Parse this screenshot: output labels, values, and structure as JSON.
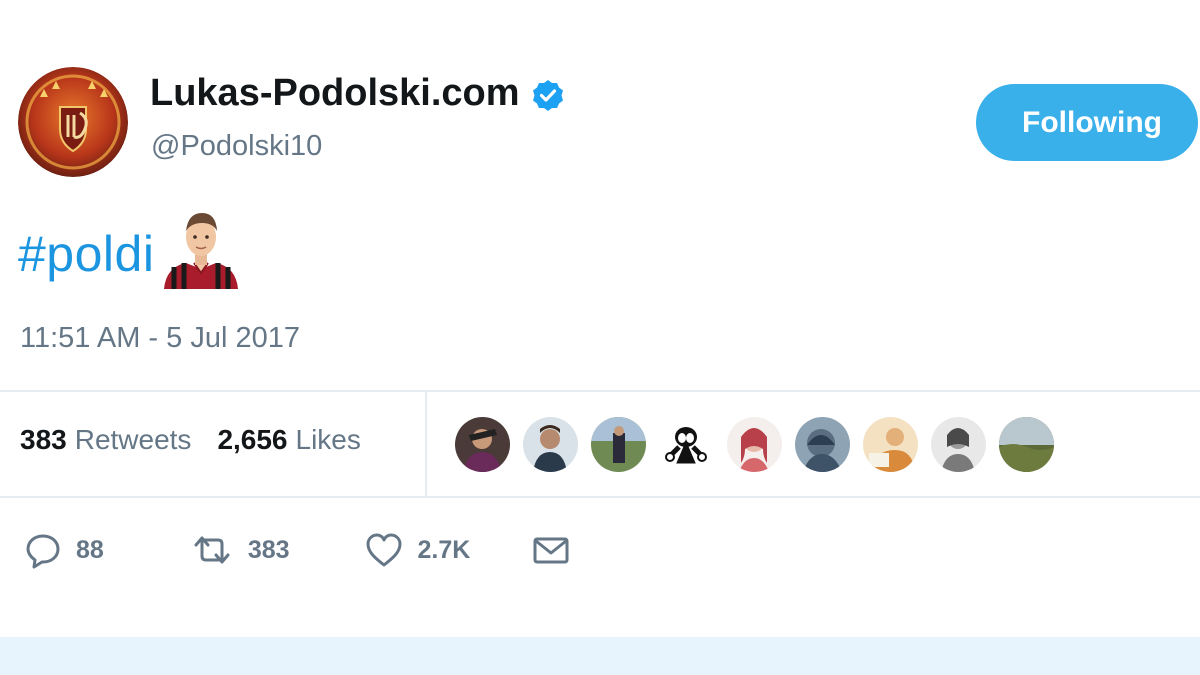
{
  "tweet": {
    "author": {
      "display_name": "Lukas-Podolski.com",
      "handle": "@Podolski10",
      "verified": true,
      "avatar_icon": "club-crest-avatar"
    },
    "follow_button_label": "Following",
    "text": {
      "hashtag": "#poldi",
      "emoji": "footballer-emoji"
    },
    "timestamp": "11:51 AM - 5 Jul 2017",
    "stats": {
      "retweets_count": "383",
      "retweets_label": "Retweets",
      "likes_count": "2,656",
      "likes_label": "Likes"
    },
    "liker_avatars": [
      "avatar-1",
      "avatar-2",
      "avatar-3",
      "avatar-4",
      "avatar-5",
      "avatar-6",
      "avatar-7",
      "avatar-8",
      "avatar-9"
    ],
    "actions": {
      "reply_count": "88",
      "retweet_count": "383",
      "like_count": "2.7K",
      "message_icon": "envelope-icon"
    }
  },
  "colors": {
    "accent": "#1b95e0",
    "follow_button": "#3ab0ea",
    "muted_text": "#657786",
    "divider": "#e6ecf0"
  }
}
